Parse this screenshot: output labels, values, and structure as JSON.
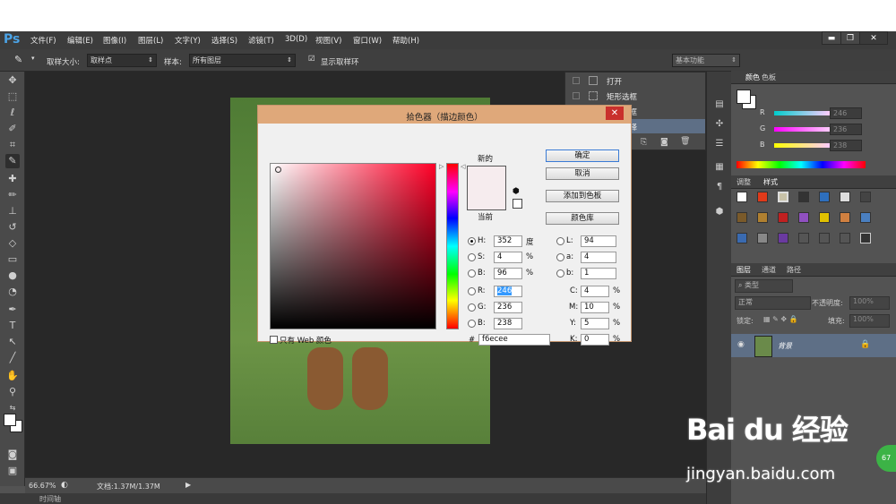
{
  "app": {
    "logo": "Ps"
  },
  "menu": [
    "文件(F)",
    "编辑(E)",
    "图像(I)",
    "图层(L)",
    "文字(Y)",
    "选择(S)",
    "滤镜(T)",
    "3D(D)",
    "视图(V)",
    "窗口(W)",
    "帮助(H)"
  ],
  "window_controls": {
    "minimize": "▬",
    "restore": "❐",
    "close": "✕"
  },
  "options": {
    "sample_size_label": "取样大小:",
    "sample_size_value": "取样点",
    "sample_label": "样本:",
    "sample_value": "所有图层",
    "show_ring_label": "显示取样环",
    "workspace": "基本功能"
  },
  "history": [
    "打开",
    "矩形选框",
    "矩形选框",
    "取消选择"
  ],
  "color_panel": {
    "tabs": [
      "颜色",
      "色板"
    ],
    "r": "246",
    "g": "236",
    "b": "238",
    "accent": "#f6ecee"
  },
  "styles_panel": {
    "tabs": [
      "调整",
      "样式"
    ]
  },
  "layers_panel": {
    "tabs": [
      "图层",
      "通道",
      "路径"
    ],
    "filter": "类型",
    "blend_mode": "正常",
    "opacity_label": "不透明度:",
    "opacity_value": "100%",
    "lock_label": "锁定:",
    "fill_label": "填充:",
    "fill_value": "100%",
    "layer_name": "背景"
  },
  "status": {
    "zoom": "66.67%",
    "doc": "文档:1.37M/1.37M",
    "timeline": "时间轴"
  },
  "dialog": {
    "title": "拾色器（描边颜色）",
    "close": "✕",
    "new_label": "新的",
    "current_label": "当前",
    "buttons": {
      "ok": "确定",
      "cancel": "取消",
      "add_swatch": "添加到色板",
      "library": "颜色库"
    },
    "web_only": "只有 Web 颜色",
    "hsb": {
      "h": "352",
      "s": "4",
      "b": "96",
      "h_unit": "度",
      "pct": "%"
    },
    "rgb": {
      "r": "246",
      "g": "236",
      "b": "238"
    },
    "lab": {
      "l": "94",
      "a": "4",
      "b": "1"
    },
    "cmyk": {
      "c": "4",
      "m": "10",
      "y": "5",
      "k": "0"
    },
    "hex_label": "#",
    "hex": "f6ecee",
    "labels": {
      "h": "H:",
      "s": "S:",
      "b": "B:",
      "r": "R:",
      "g": "G:",
      "bb": "B:",
      "l": "L:",
      "a": "a:",
      "lb": "b:",
      "c": "C:",
      "m": "M:",
      "y": "Y:",
      "k": "K:"
    }
  },
  "watermark": {
    "logo": "Bai du 经验",
    "url": "jingyan.baidu.com"
  },
  "badge": "67"
}
